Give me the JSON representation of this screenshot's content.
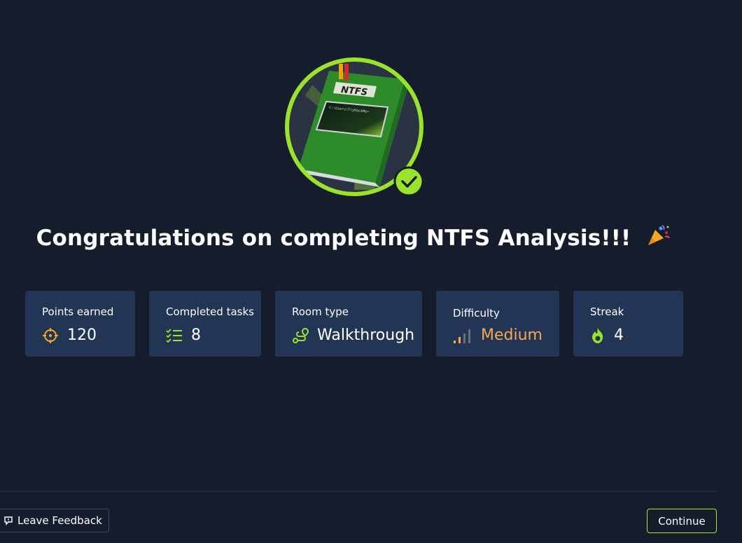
{
  "badge": {
    "book_label": "NTFS",
    "screen_text": "C:\\Users\\TryHackMe>",
    "completed": true
  },
  "title": "Congratulations on completing NTFS Analysis!!!",
  "title_emoji": "party-popper-icon",
  "stats": [
    {
      "label": "Points earned",
      "value": "120",
      "icon": "target-icon",
      "color": "#f5a623"
    },
    {
      "label": "Completed tasks",
      "value": "8",
      "icon": "checklist-icon",
      "color": "#9be22d"
    },
    {
      "label": "Room type",
      "value": "Walkthrough",
      "icon": "route-icon",
      "color": "#9be22d"
    },
    {
      "label": "Difficulty",
      "value": "Medium",
      "icon": "signal-bars-icon",
      "color": "#f5a852"
    },
    {
      "label": "Streak",
      "value": "4",
      "icon": "flame-icon",
      "color": "#9be22d"
    }
  ],
  "footer": {
    "feedback_label": "Leave Feedback",
    "continue_label": "Continue"
  },
  "colors": {
    "background": "#151c2b",
    "card": "#223554",
    "accent": "#a3ea2a",
    "orange": "#f5a623"
  }
}
